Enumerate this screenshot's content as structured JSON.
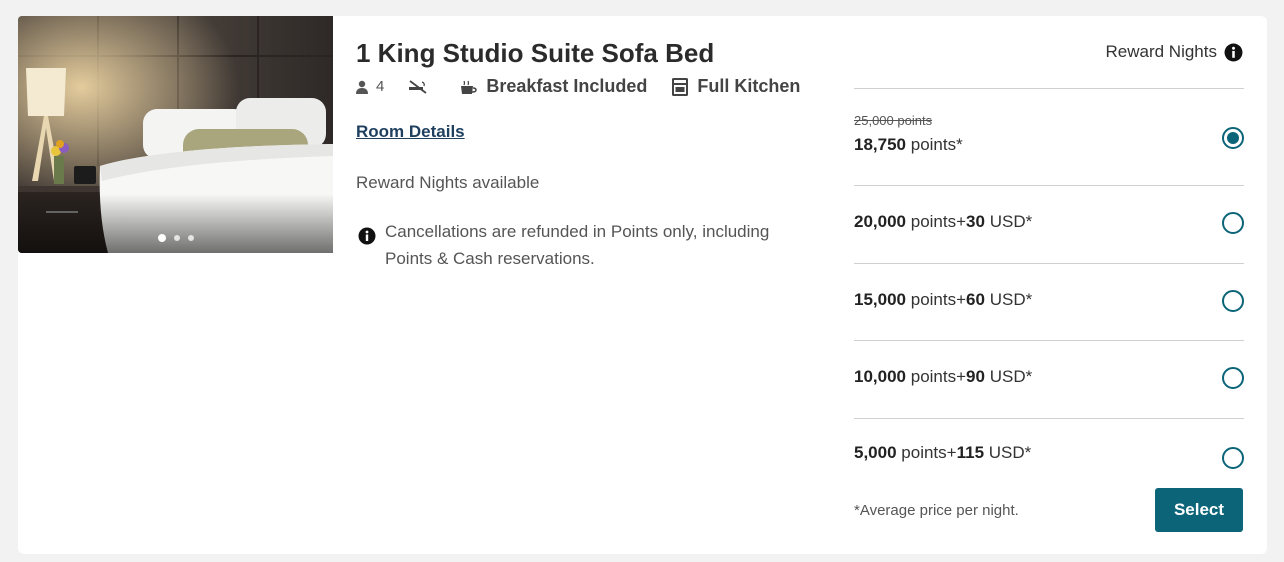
{
  "room": {
    "title": "1 King Studio Suite Sofa Bed",
    "guests": "4",
    "amenities": [
      {
        "icon": "no-smoking-icon",
        "label": ""
      },
      {
        "icon": "coffee-cup-icon",
        "label": "Breakfast Included"
      },
      {
        "icon": "stove-icon",
        "label": "Full Kitchen"
      }
    ],
    "details_link": "Room Details",
    "reward_available": "Reward Nights available",
    "cancellation_note": "Cancellations are refunded in Points only, including Points & Cash reservations."
  },
  "gallery": {
    "current": 1,
    "total": 3
  },
  "rates": {
    "header": "Reward Nights",
    "options": [
      {
        "original": "25,000 points",
        "points": "18,750",
        "points_unit": "points*",
        "cash": "",
        "cash_unit": "",
        "selected": true
      },
      {
        "original": "",
        "points": "20,000",
        "points_unit": "points",
        "plus": "+",
        "cash": "30",
        "cash_unit": "USD*",
        "selected": false
      },
      {
        "original": "",
        "points": "15,000",
        "points_unit": "points",
        "plus": "+",
        "cash": "60",
        "cash_unit": "USD*",
        "selected": false
      },
      {
        "original": "",
        "points": "10,000",
        "points_unit": "points",
        "plus": "+",
        "cash": "90",
        "cash_unit": "USD*",
        "selected": false
      },
      {
        "original": "",
        "points": "5,000",
        "points_unit": "points",
        "plus": "+",
        "cash": "115",
        "cash_unit": "USD*",
        "selected": false
      }
    ],
    "footnote": "*Average price per night.",
    "select_label": "Select"
  },
  "colors": {
    "accent": "#0b6478",
    "link": "#1f3f5f"
  }
}
